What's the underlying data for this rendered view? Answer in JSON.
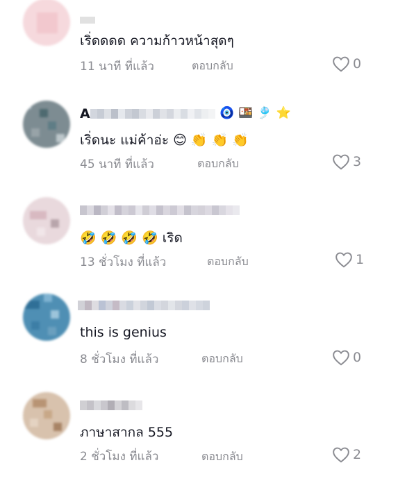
{
  "comments": [
    {
      "text": "เริ่ดดดด ความก้าวหน้าสุดๆ",
      "time": "11 นาที ที่แล้ว",
      "reply": "ตอบกลับ",
      "likes": "0"
    },
    {
      "name_initial": "A",
      "badges": [
        "🧿",
        "🍱",
        "🎐",
        "⭐"
      ],
      "text": "เริ่ดนะ แม่ค้าอ่ะ 😊 👏 👏 👏",
      "time": "45 นาที ที่แล้ว",
      "reply": "ตอบกลับ",
      "likes": "3"
    },
    {
      "text": "🤣 🤣 🤣 🤣 เริด",
      "time": "13 ชั่วโมง ที่แล้ว",
      "reply": "ตอบกลับ",
      "likes": "1"
    },
    {
      "text": "this is genius",
      "time": "8 ชั่วโมง ที่แล้ว",
      "reply": "ตอบกลับ",
      "likes": "0"
    },
    {
      "text": "ภาษาสากล 555",
      "time": "2 ชั่วโมง ที่แล้ว",
      "reply": "ตอบกลับ",
      "likes": "2"
    }
  ],
  "colors": {
    "secondary_text": "#8a8b91",
    "primary_text": "#161823"
  },
  "icons": {
    "like": "heart-outline-icon"
  }
}
